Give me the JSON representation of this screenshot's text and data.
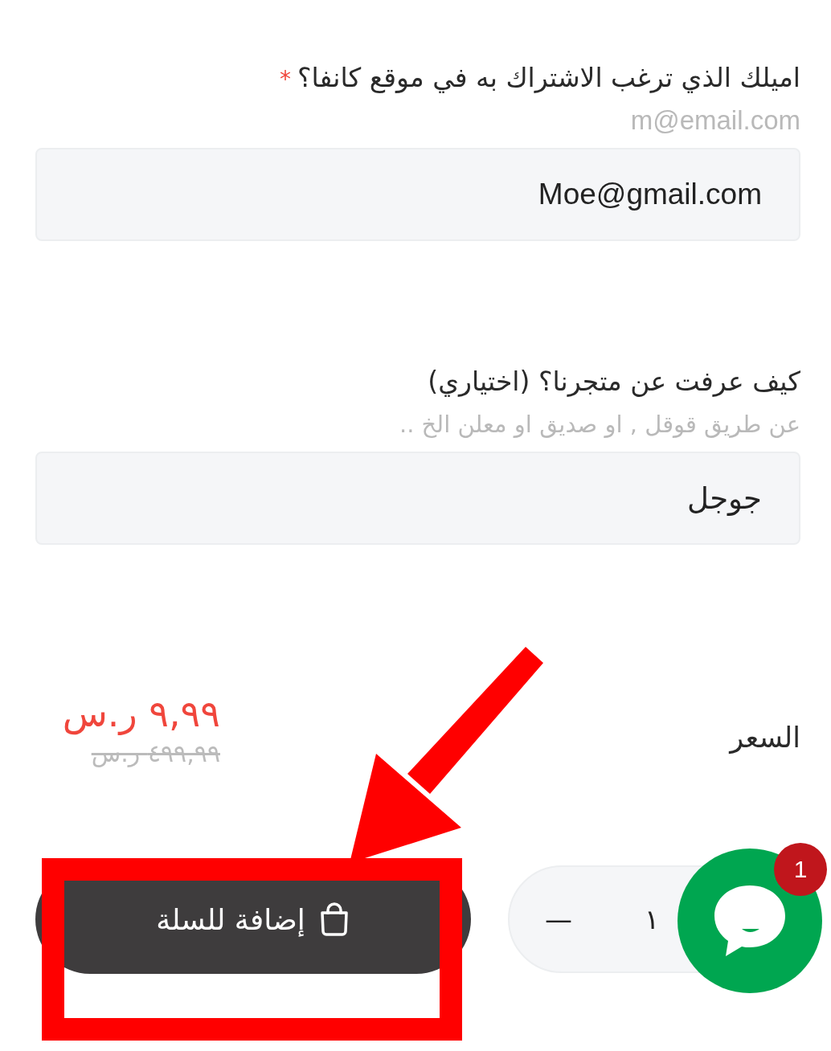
{
  "fields": [
    {
      "label": "اميلك الذي ترغب الاشتراك به في موقع كانفا؟",
      "required_mark": "*",
      "hint": "m@email.com",
      "value": "Moe@gmail.com"
    },
    {
      "label": "كيف عرفت عن متجرنا؟ (اختياري)",
      "hint": "عن طريق قوقل , او صديق او معلن الخ ..",
      "value": "جوجل"
    }
  ],
  "price": {
    "label": "السعر",
    "sale": "٩,٩٩ ر.س",
    "original": "٤٩٩,٩٩ ر.س"
  },
  "quantity": {
    "minus": "—",
    "value": "١"
  },
  "add_to_cart": {
    "label": "إضافة للسلة"
  },
  "chat": {
    "badge": "1"
  },
  "annotations": {
    "arrow": true,
    "highlight_frame": true
  }
}
